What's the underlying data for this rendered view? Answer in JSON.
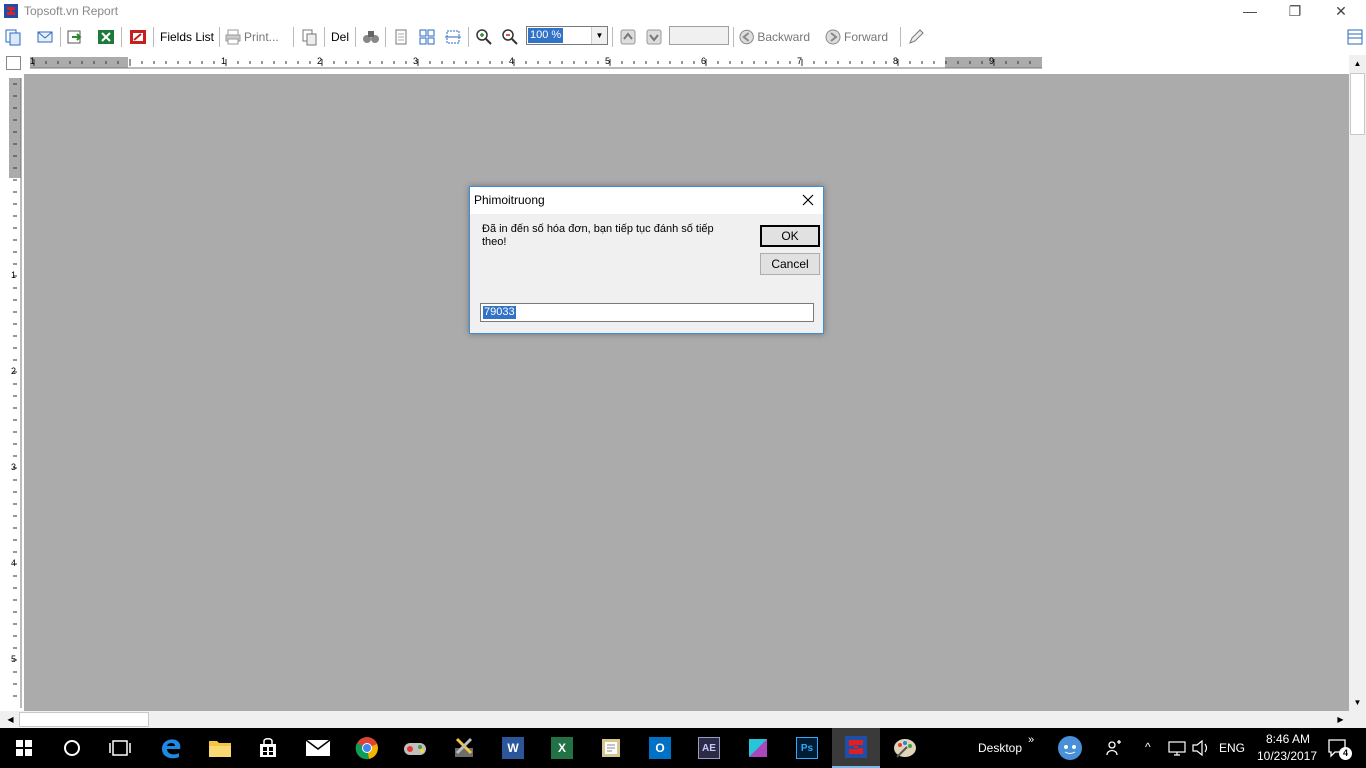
{
  "window": {
    "title": "Topsoft.vn Report",
    "minimize_glyph": "—",
    "restore_glyph": "❐",
    "close_glyph": "✕"
  },
  "toolbar": {
    "fields_list_label": "Fields List",
    "print_label": "Print...",
    "del_label": "Del",
    "zoom_value": "100 %",
    "backward_label": "Backward",
    "forward_label": "Forward"
  },
  "ruler": {
    "horizontal_numbers": [
      "1",
      "2",
      "3",
      "4",
      "5",
      "6",
      "7",
      "8",
      "9"
    ],
    "vertical_numbers": [
      "1",
      "2",
      "3",
      "4",
      "5"
    ]
  },
  "dialog": {
    "title": "Phimoitruong",
    "message": "Đã in đến số hóa đơn, bạn tiếp tục đánh số tiếp theo!",
    "ok_label": "OK",
    "cancel_label": "Cancel",
    "input_value": "79033"
  },
  "taskbar": {
    "desktop_label": "Desktop",
    "language": "ENG",
    "time": "8:46 AM",
    "date": "10/23/2017",
    "notification_count": "4",
    "word_letter": "W",
    "excel_letter": "X",
    "outlook_letter": "O",
    "ae_letter": "AE",
    "ps_letter": "Ps"
  },
  "colors": {
    "workspace": "#ababab",
    "selection": "#3173c6",
    "dialog_border": "#3a8fd6",
    "taskbar": "#000000"
  }
}
